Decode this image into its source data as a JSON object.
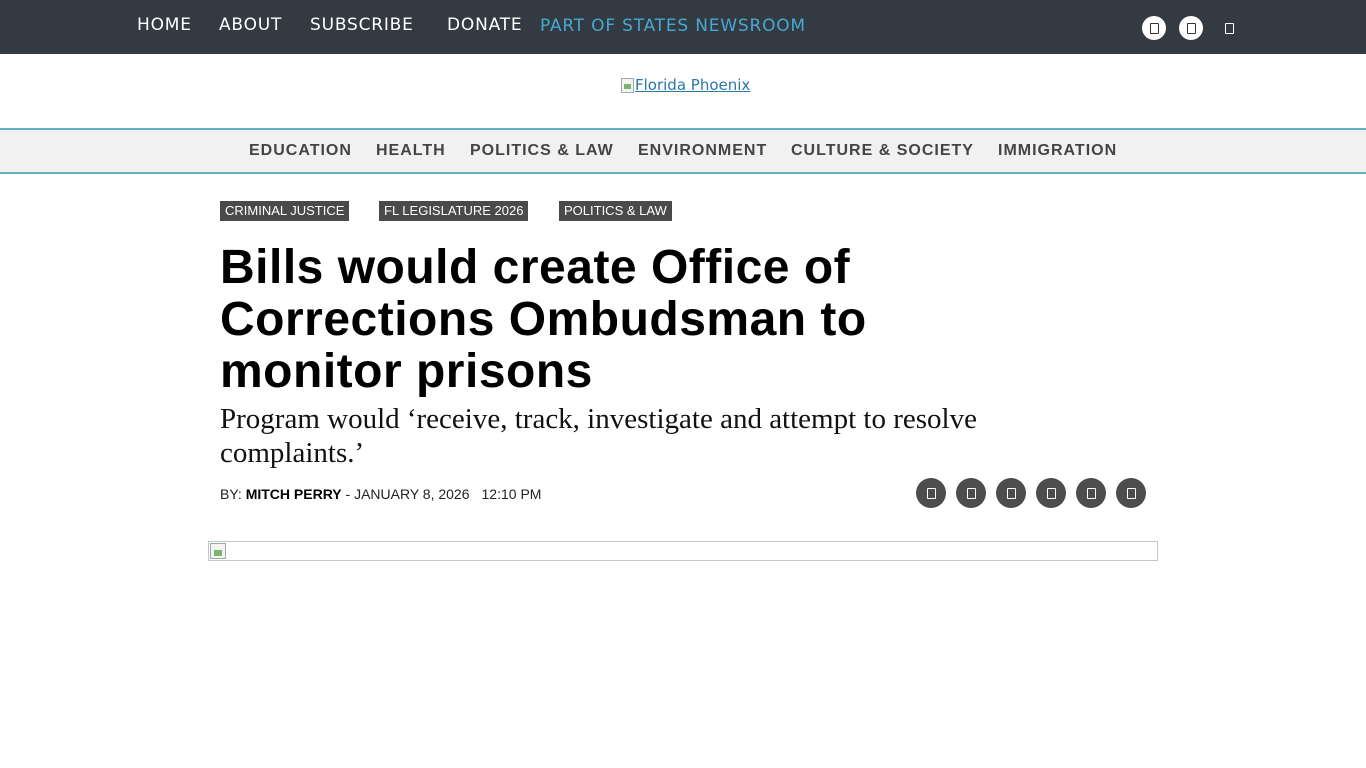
{
  "top_nav": {
    "home": "HOME",
    "about": "ABOUT",
    "subscribe": "SUBSCRIBE",
    "donate": "DONATE",
    "states_newsroom": "PART OF STATES NEWSROOM",
    "icons": [
      "facebook-icon",
      "twitter-icon",
      "search-icon"
    ]
  },
  "logo": {
    "alt": "Florida Phoenix"
  },
  "category_nav": [
    "EDUCATION",
    "HEALTH",
    "POLITICS & LAW",
    "ENVIRONMENT",
    "CULTURE & SOCIETY",
    "IMMIGRATION"
  ],
  "article": {
    "tags": [
      "CRIMINAL JUSTICE",
      "FL LEGISLATURE 2026",
      "POLITICS & LAW"
    ],
    "headline": "Bills would create Office of Corrections Ombudsman to monitor prisons",
    "subhead": "Program would ‘receive, track, investigate and attempt to resolve complaints.’",
    "byline_prefix": "BY: ",
    "author": "MITCH PERRY",
    "date": " - JANUARY 8, 2026",
    "time": "12:10 PM",
    "share_icons": [
      "facebook-icon",
      "twitter-icon",
      "linkedin-icon",
      "email-icon",
      "print-icon",
      "share-icon"
    ]
  },
  "colors": {
    "top_bar_bg": "#333a42",
    "accent_blue": "#46a9d3",
    "category_border": "#5fb3c5",
    "tag_bg": "#4a4a4a"
  }
}
